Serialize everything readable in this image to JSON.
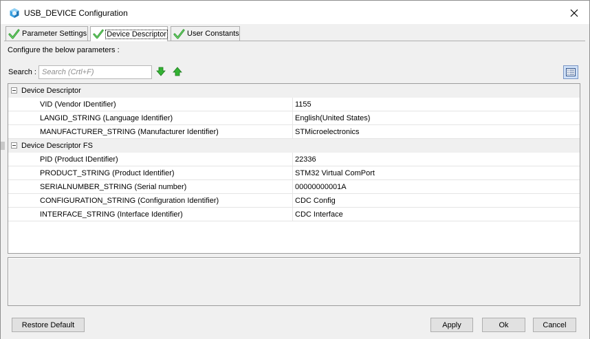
{
  "window": {
    "title": "USB_DEVICE Configuration",
    "accent_color": "#3aa0e0"
  },
  "tabs": [
    {
      "label": "Parameter Settings",
      "active": false,
      "icon": "check-icon"
    },
    {
      "label": "Device Descriptor",
      "active": true,
      "icon": "check-icon"
    },
    {
      "label": "User Constants",
      "active": false,
      "icon": "check-icon"
    }
  ],
  "configure_label": "Configure the below parameters :",
  "search": {
    "label": "Search :",
    "placeholder": "Search (Crtl+F)",
    "value": ""
  },
  "groups": [
    {
      "name": "Device Descriptor",
      "params": [
        {
          "name": "VID (Vendor IDentifier)",
          "value": "1155"
        },
        {
          "name": "LANGID_STRING (Language Identifier)",
          "value": "English(United States)"
        },
        {
          "name": "MANUFACTURER_STRING (Manufacturer Identifier)",
          "value": "STMicroelectronics"
        }
      ]
    },
    {
      "name": "Device Descriptor FS",
      "params": [
        {
          "name": "PID (Product IDentifier)",
          "value": "22336"
        },
        {
          "name": "PRODUCT_STRING (Product Identifier)",
          "value": "STM32 Virtual ComPort"
        },
        {
          "name": "SERIALNUMBER_STRING (Serial number)",
          "value": "00000000001A"
        },
        {
          "name": "CONFIGURATION_STRING (Configuration Identifier)",
          "value": "CDC Config"
        },
        {
          "name": "INTERFACE_STRING (Interface Identifier)",
          "value": "CDC Interface"
        }
      ]
    }
  ],
  "buttons": {
    "restore_default": "Restore Default",
    "apply": "Apply",
    "ok": "Ok",
    "cancel": "Cancel"
  }
}
